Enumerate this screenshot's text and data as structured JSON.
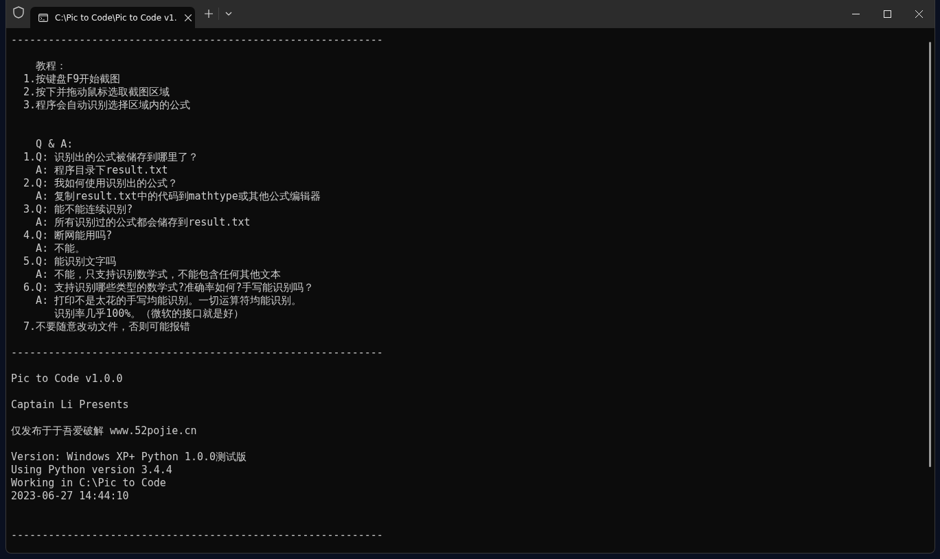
{
  "tabs": [
    {
      "title": "C:\\Pic to Code\\Pic to Code v1.",
      "selected": true
    }
  ],
  "console": {
    "lines": [
      {
        "kind": "text",
        "text": "------------------------------------------------------------"
      },
      {
        "kind": "blank"
      },
      {
        "kind": "text",
        "text": "    教程："
      },
      {
        "kind": "text",
        "text": "  1.按键盘F9开始截图"
      },
      {
        "kind": "text",
        "text": "  2.按下并拖动鼠标选取截图区域"
      },
      {
        "kind": "text",
        "text": "  3.程序会自动识别选择区域内的公式"
      },
      {
        "kind": "blank"
      },
      {
        "kind": "blank"
      },
      {
        "kind": "text",
        "text": "    Q & A:"
      },
      {
        "kind": "text",
        "text": "  1.Q: 识别出的公式被储存到哪里了？"
      },
      {
        "kind": "text",
        "text": "    A: 程序目录下result.txt"
      },
      {
        "kind": "text",
        "text": "  2.Q: 我如何使用识别出的公式？"
      },
      {
        "kind": "text",
        "text": "    A: 复制result.txt中的代码到mathtype或其他公式编辑器"
      },
      {
        "kind": "text",
        "text": "  3.Q: 能不能连续识别?"
      },
      {
        "kind": "text",
        "text": "    A: 所有识别过的公式都会储存到result.txt"
      },
      {
        "kind": "text",
        "text": "  4.Q: 断网能用吗?"
      },
      {
        "kind": "text",
        "text": "    A: 不能。"
      },
      {
        "kind": "text",
        "text": "  5.Q: 能识别文字吗"
      },
      {
        "kind": "text",
        "text": "    A: 不能，只支持识别数学式，不能包含任何其他文本"
      },
      {
        "kind": "text",
        "text": "  6.Q: 支持识别哪些类型的数学式?准确率如何?手写能识别吗？"
      },
      {
        "kind": "text",
        "text": "    A: 打印不是太花的手写均能识别。一切运算符均能识别。"
      },
      {
        "kind": "text",
        "text": "       识别率几乎100%。（微软的接口就是好）"
      },
      {
        "kind": "text",
        "text": "  7.不要随意改动文件，否则可能报错"
      },
      {
        "kind": "blank"
      },
      {
        "kind": "text",
        "text": "------------------------------------------------------------"
      },
      {
        "kind": "blank"
      },
      {
        "kind": "text",
        "text": "Pic to Code v1.0.0"
      },
      {
        "kind": "blank"
      },
      {
        "kind": "text",
        "text": "Captain Li Presents"
      },
      {
        "kind": "blank"
      },
      {
        "kind": "text",
        "text": "仅发布于于吾爱破解 www.52pojie.cn"
      },
      {
        "kind": "blank"
      },
      {
        "kind": "text",
        "text": "Version: Windows XP+ Python 1.0.0测试版"
      },
      {
        "kind": "text",
        "text": "Using Python version 3.4.4"
      },
      {
        "kind": "text",
        "text": "Working in C:\\Pic to Code"
      },
      {
        "kind": "text",
        "text": "2023-06-27 14:44:10"
      },
      {
        "kind": "blank"
      },
      {
        "kind": "blank"
      },
      {
        "kind": "text",
        "text": "------------------------------------------------------------"
      }
    ]
  }
}
